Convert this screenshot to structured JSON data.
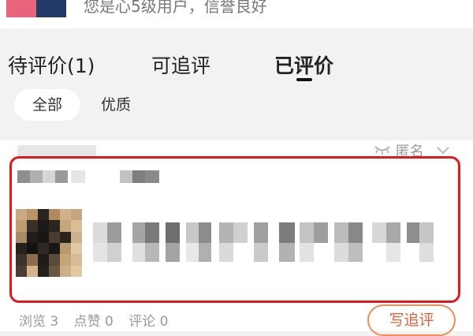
{
  "header": {
    "member_status": "您是心5级用户，信誉良好"
  },
  "tabs": [
    {
      "label": "待评价(1)",
      "active": false
    },
    {
      "label": "可追评",
      "active": false
    },
    {
      "label": "已评价",
      "active": true
    }
  ],
  "filters": [
    {
      "label": "全部",
      "selected": true
    },
    {
      "label": "优质",
      "selected": false
    }
  ],
  "review": {
    "anonymous_label": "匿名",
    "stats": {
      "views": "浏览 3",
      "likes": "点赞 0",
      "comments": "评论 0"
    },
    "follow_up_button": "写追评"
  },
  "colors": {
    "highlight_border": "#e3181d",
    "follow_up_accent": "#e8603a"
  }
}
